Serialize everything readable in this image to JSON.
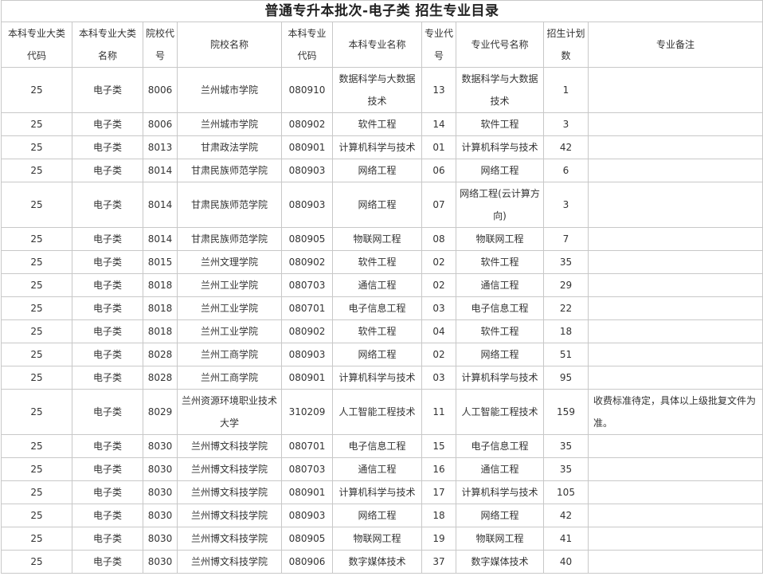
{
  "title": "普通专升本批次-电子类 招生专业目录",
  "headers": [
    "本科专业大类代码",
    "本科专业大类名称",
    "院校代号",
    "院校名称",
    "本科专业代码",
    "本科专业名称",
    "专业代号",
    "专业代号名称",
    "招生计划数",
    "专业备注"
  ],
  "rows": [
    {
      "c1": "25",
      "c2": "电子类",
      "c3": "8006",
      "c4": "兰州城市学院",
      "c5": "080910",
      "c6": "数据科学与大数据技术",
      "c7": "13",
      "c8": "数据科学与大数据技术",
      "c9": "1",
      "c10": ""
    },
    {
      "c1": "25",
      "c2": "电子类",
      "c3": "8006",
      "c4": "兰州城市学院",
      "c5": "080902",
      "c6": "软件工程",
      "c7": "14",
      "c8": "软件工程",
      "c9": "3",
      "c10": ""
    },
    {
      "c1": "25",
      "c2": "电子类",
      "c3": "8013",
      "c4": "甘肃政法学院",
      "c5": "080901",
      "c6": "计算机科学与技术",
      "c7": "01",
      "c8": "计算机科学与技术",
      "c9": "42",
      "c10": ""
    },
    {
      "c1": "25",
      "c2": "电子类",
      "c3": "8014",
      "c4": "甘肃民族师范学院",
      "c5": "080903",
      "c6": "网络工程",
      "c7": "06",
      "c8": "网络工程",
      "c9": "6",
      "c10": ""
    },
    {
      "c1": "25",
      "c2": "电子类",
      "c3": "8014",
      "c4": "甘肃民族师范学院",
      "c5": "080903",
      "c6": "网络工程",
      "c7": "07",
      "c8": "网络工程(云计算方向)",
      "c9": "3",
      "c10": ""
    },
    {
      "c1": "25",
      "c2": "电子类",
      "c3": "8014",
      "c4": "甘肃民族师范学院",
      "c5": "080905",
      "c6": "物联网工程",
      "c7": "08",
      "c8": "物联网工程",
      "c9": "7",
      "c10": ""
    },
    {
      "c1": "25",
      "c2": "电子类",
      "c3": "8015",
      "c4": "兰州文理学院",
      "c5": "080902",
      "c6": "软件工程",
      "c7": "02",
      "c8": "软件工程",
      "c9": "35",
      "c10": ""
    },
    {
      "c1": "25",
      "c2": "电子类",
      "c3": "8018",
      "c4": "兰州工业学院",
      "c5": "080703",
      "c6": "通信工程",
      "c7": "02",
      "c8": "通信工程",
      "c9": "29",
      "c10": ""
    },
    {
      "c1": "25",
      "c2": "电子类",
      "c3": "8018",
      "c4": "兰州工业学院",
      "c5": "080701",
      "c6": "电子信息工程",
      "c7": "03",
      "c8": "电子信息工程",
      "c9": "22",
      "c10": ""
    },
    {
      "c1": "25",
      "c2": "电子类",
      "c3": "8018",
      "c4": "兰州工业学院",
      "c5": "080902",
      "c6": "软件工程",
      "c7": "04",
      "c8": "软件工程",
      "c9": "18",
      "c10": ""
    },
    {
      "c1": "25",
      "c2": "电子类",
      "c3": "8028",
      "c4": "兰州工商学院",
      "c5": "080903",
      "c6": "网络工程",
      "c7": "02",
      "c8": "网络工程",
      "c9": "51",
      "c10": ""
    },
    {
      "c1": "25",
      "c2": "电子类",
      "c3": "8028",
      "c4": "兰州工商学院",
      "c5": "080901",
      "c6": "计算机科学与技术",
      "c7": "03",
      "c8": "计算机科学与技术",
      "c9": "95",
      "c10": ""
    },
    {
      "c1": "25",
      "c2": "电子类",
      "c3": "8029",
      "c4": "兰州资源环境职业技术大学",
      "c5": "310209",
      "c6": "人工智能工程技术",
      "c7": "11",
      "c8": "人工智能工程技术",
      "c9": "159",
      "c10": "收费标准待定，具体以上级批复文件为准。"
    },
    {
      "c1": "25",
      "c2": "电子类",
      "c3": "8030",
      "c4": "兰州博文科技学院",
      "c5": "080701",
      "c6": "电子信息工程",
      "c7": "15",
      "c8": "电子信息工程",
      "c9": "35",
      "c10": ""
    },
    {
      "c1": "25",
      "c2": "电子类",
      "c3": "8030",
      "c4": "兰州博文科技学院",
      "c5": "080703",
      "c6": "通信工程",
      "c7": "16",
      "c8": "通信工程",
      "c9": "35",
      "c10": ""
    },
    {
      "c1": "25",
      "c2": "电子类",
      "c3": "8030",
      "c4": "兰州博文科技学院",
      "c5": "080901",
      "c6": "计算机科学与技术",
      "c7": "17",
      "c8": "计算机科学与技术",
      "c9": "105",
      "c10": ""
    },
    {
      "c1": "25",
      "c2": "电子类",
      "c3": "8030",
      "c4": "兰州博文科技学院",
      "c5": "080903",
      "c6": "网络工程",
      "c7": "18",
      "c8": "网络工程",
      "c9": "42",
      "c10": ""
    },
    {
      "c1": "25",
      "c2": "电子类",
      "c3": "8030",
      "c4": "兰州博文科技学院",
      "c5": "080905",
      "c6": "物联网工程",
      "c7": "19",
      "c8": "物联网工程",
      "c9": "41",
      "c10": ""
    },
    {
      "c1": "25",
      "c2": "电子类",
      "c3": "8030",
      "c4": "兰州博文科技学院",
      "c5": "080906",
      "c6": "数字媒体技术",
      "c7": "37",
      "c8": "数字媒体技术",
      "c9": "40",
      "c10": ""
    }
  ]
}
